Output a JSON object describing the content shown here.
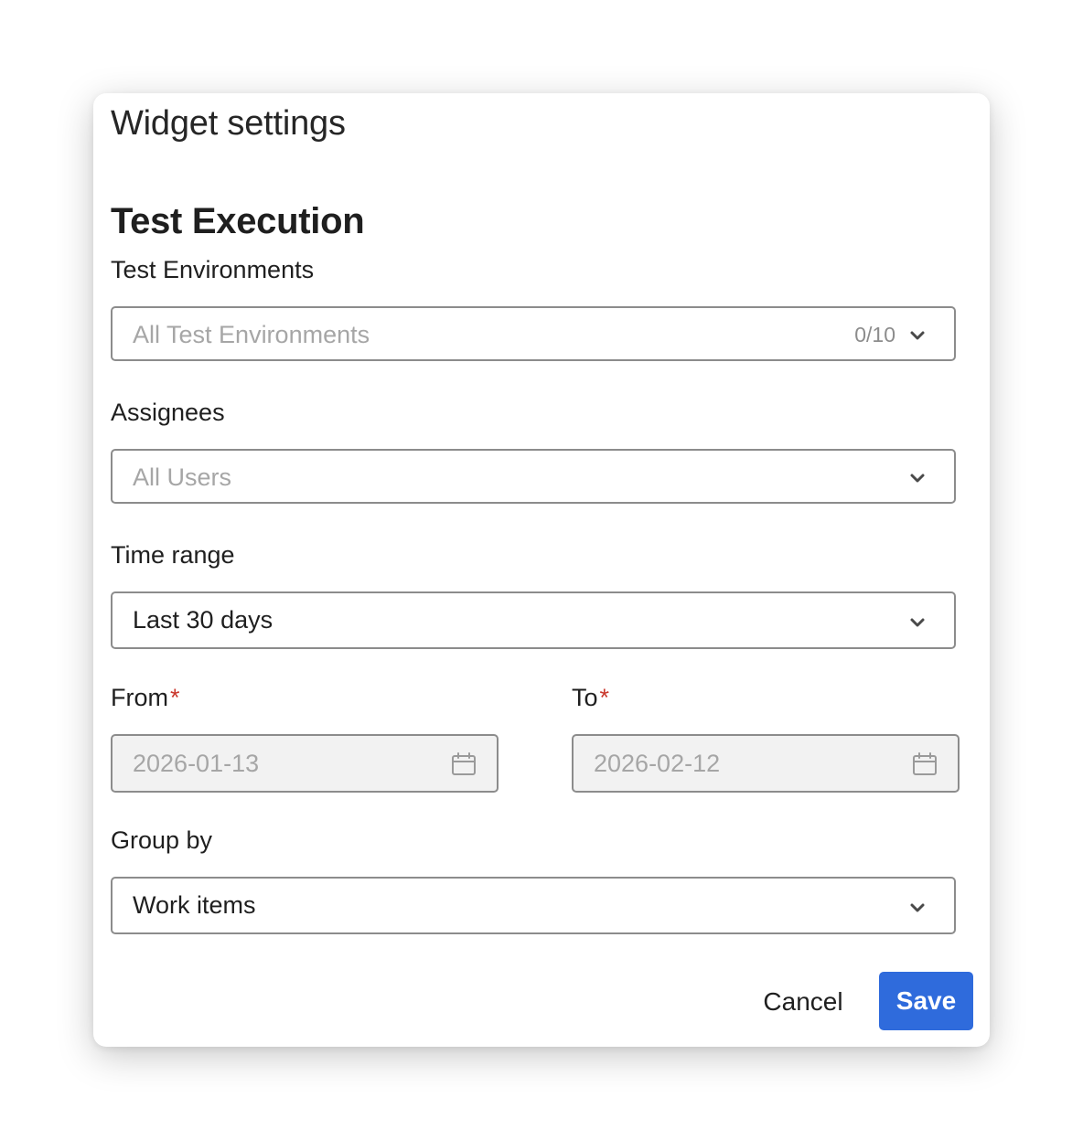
{
  "dialog": {
    "title": "Widget settings"
  },
  "section": {
    "title": "Test Execution"
  },
  "fields": {
    "test_environments": {
      "label": "Test Environments",
      "placeholder": "All Test Environments",
      "count": "0/10"
    },
    "assignees": {
      "label": "Assignees",
      "placeholder": "All Users"
    },
    "time_range": {
      "label": "Time range",
      "value": "Last 30 days"
    },
    "from": {
      "label": "From",
      "required_mark": "*",
      "value": "2026-01-13"
    },
    "to": {
      "label": "To",
      "required_mark": "*",
      "value": "2026-02-12"
    },
    "group_by": {
      "label": "Group by",
      "value": "Work items"
    }
  },
  "footer": {
    "cancel_label": "Cancel",
    "save_label": "Save"
  },
  "icons": {
    "select_chevron": "chevron-down-icon",
    "date_picker": "calendar-icon"
  },
  "colors": {
    "primary": "#2f6bdc",
    "required": "#c9372c",
    "border": "#8c8c8c",
    "disabled_bg": "#f2f2f2",
    "placeholder": "#a6a6a6"
  }
}
